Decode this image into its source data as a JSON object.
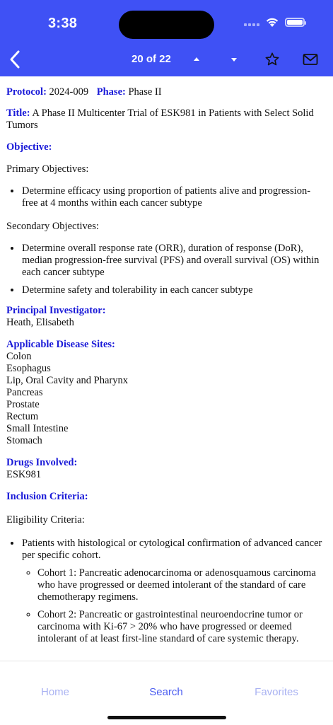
{
  "status_bar": {
    "time": "3:38"
  },
  "nav": {
    "counter": "20 of 22"
  },
  "protocol": {
    "protocol_label": "Protocol:",
    "protocol_value": "2024-009",
    "phase_label": "Phase:",
    "phase_value": "Phase II",
    "title_label": "Title:",
    "title_value": "A Phase II Multicenter Trial of ESK981 in Patients with Select Solid Tumors"
  },
  "objective": {
    "heading": "Objective:",
    "primary_label": "Primary Objectives:",
    "primary_items": [
      "Determine efficacy using proportion of patients alive and progression-free at 4 months within each cancer subtype"
    ],
    "secondary_label": "Secondary Objectives:",
    "secondary_items": [
      "Determine overall response rate (ORR), duration of response (DoR), median progression-free survival (PFS) and overall survival (OS) within each cancer subtype",
      "Determine safety and tolerability in each cancer subtype"
    ]
  },
  "investigator": {
    "heading": "Principal Investigator:",
    "name": "Heath, Elisabeth"
  },
  "disease_sites": {
    "heading": "Applicable Disease Sites:",
    "items": [
      "Colon",
      "Esophagus",
      "Lip, Oral Cavity and Pharynx",
      "Pancreas",
      "Prostate",
      "Rectum",
      "Small Intestine",
      "Stomach"
    ]
  },
  "drugs": {
    "heading": "Drugs Involved:",
    "value": "ESK981"
  },
  "inclusion": {
    "heading": "Inclusion Criteria:",
    "eligibility_label": "Eligibility Criteria:",
    "bullet": "Patients with histological or cytological confirmation of advanced cancer per specific cohort.",
    "cohorts": [
      "Cohort 1: Pancreatic adenocarcinoma or adenosquamous carcinoma who have progressed or deemed intolerant of the standard of care chemotherapy regimens.",
      "Cohort 2: Pancreatic or gastrointestinal neuroendocrine tumor or carcinoma with Ki-67 > 20% who have progressed or deemed intolerant of at least first-line standard of care systemic therapy."
    ]
  },
  "tabs": {
    "home": "Home",
    "search": "Search",
    "favorites": "Favorites"
  },
  "colors": {
    "header_bg": "#3f51f5",
    "label_blue": "#1a1ad8",
    "tab_active": "#4a5cf0",
    "tab_inactive": "#a9b2f2"
  },
  "icons": {
    "back": "chevron-left-icon",
    "up": "triangle-up-icon",
    "down": "triangle-down-icon",
    "favorite": "star-outline-icon",
    "email": "envelope-icon",
    "wifi": "wifi-icon",
    "battery": "battery-icon"
  }
}
